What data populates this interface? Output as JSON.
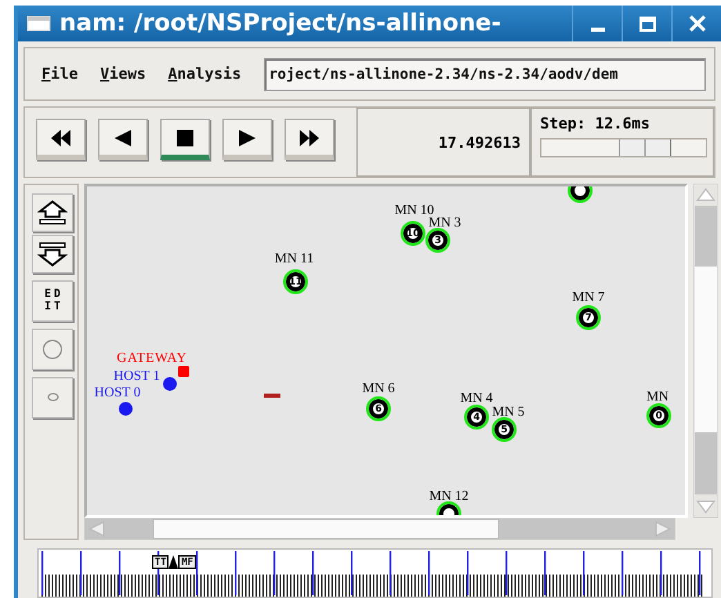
{
  "window": {
    "title": "nam: /root/NSProject/ns-allinone-"
  },
  "menu": [
    {
      "label": "File"
    },
    {
      "label": "Views"
    },
    {
      "label": "Analysis"
    }
  ],
  "trace_file": {
    "value": "roject/ns-allinone-2.34/ns-2.34/aodv/dem"
  },
  "playback_buttons": [
    {
      "kind": "rewind",
      "selected": false
    },
    {
      "kind": "back",
      "selected": false
    },
    {
      "kind": "stop",
      "selected": true
    },
    {
      "kind": "play",
      "selected": false
    },
    {
      "kind": "forward",
      "selected": false
    }
  ],
  "time": "17.492613",
  "step": {
    "label": "Step: 12.6ms",
    "level": 0.63
  },
  "tools": [
    {
      "kind": "zoom-in"
    },
    {
      "kind": "zoom-out"
    },
    {
      "kind": "edit",
      "label": "EDIT"
    },
    {
      "kind": "circle-large"
    },
    {
      "kind": "circle-small"
    }
  ],
  "nodes": [
    {
      "kind": "mobile"
    },
    {
      "kind": "mobile",
      "label": "MN 10",
      "number": "10"
    },
    {
      "kind": "mobile",
      "label": "MN 3",
      "number": "3"
    },
    {
      "kind": "mobile",
      "label": "MN 11",
      "number": "11"
    },
    {
      "kind": "mobile",
      "label": "MN 7",
      "number": "7"
    },
    {
      "kind": "gateway",
      "label": "GATEWAY"
    },
    {
      "kind": "host",
      "label": "HOST 1"
    },
    {
      "kind": "host",
      "label": "HOST 0"
    },
    {
      "kind": "mobile",
      "label": "MN 6",
      "number": "6"
    },
    {
      "kind": "mobile",
      "label": "MN 4",
      "number": "4"
    },
    {
      "kind": "mobile",
      "label": "MN 5",
      "number": "5"
    },
    {
      "kind": "mobile",
      "label": "MN",
      "number": "0"
    },
    {
      "kind": "mobile",
      "label": "MN 12"
    }
  ],
  "timeline": {
    "markers": [
      {
        "label": "TT"
      },
      {
        "label": "MF"
      }
    ]
  }
}
